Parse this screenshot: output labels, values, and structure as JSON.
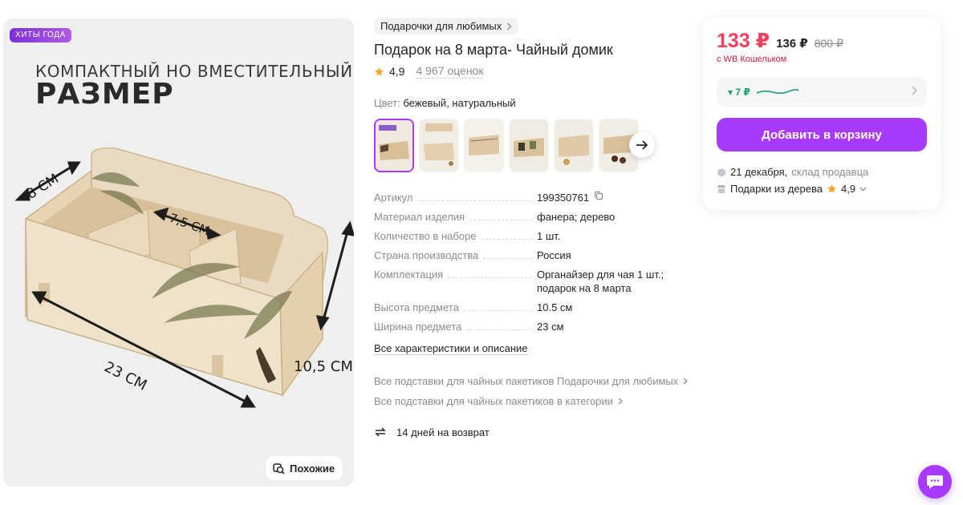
{
  "hero": {
    "badge": "ХИТЫ ГОДА",
    "headline_line1": "КОМПАКТНЫЙ НО ВМЕСТИТЕЛЬНЫЙ",
    "headline_line2": "РАЗМЕР",
    "dimensions": {
      "depth": "8 СМ",
      "compartment": "7,5 СМ",
      "length": "23 СМ",
      "height": "10,5 СМ"
    },
    "similar_button": "Похожие",
    "similar_icon": "search-similar-icon"
  },
  "product": {
    "brand": "Подарочки для любимых",
    "title": "Подарок на 8 марта- Чайный домик",
    "rating": "4,9",
    "reviews": "4 967 оценок",
    "color_label": "Цвет:",
    "color_value": "бежевый, натуральный",
    "thumbnail_count": 6
  },
  "specs": [
    {
      "key": "Артикул",
      "value": "199350761"
    },
    {
      "key": "Материал изделия",
      "value": "фанера; дерево"
    },
    {
      "key": "Количество в наборе",
      "value": "1 шт."
    },
    {
      "key": "Страна производства",
      "value": "Россия"
    },
    {
      "key": "Комплектация",
      "value": "Органайзер для чая 1 шт.; подарок на 8 марта"
    },
    {
      "key": "Высота предмета",
      "value": "10.5 см"
    },
    {
      "key": "Ширина предмета",
      "value": "23 см"
    }
  ],
  "links": {
    "all_specs": "Все характеристики и описание",
    "brand_category": "Все подставки для чайных пакетиков Подарочки для любимых",
    "category": "Все подставки для чайных пакетиков в категории",
    "returns": "14 дней на возврат"
  },
  "price_card": {
    "price": "133 ₽",
    "price_wallet": "136 ₽",
    "price_old": "800 ₽",
    "wallet_note": "с WB Кошельком",
    "price_drop": "▾ 7 ₽",
    "add_to_cart": "Добавить в корзину",
    "delivery_date": "21 декабря,",
    "delivery_from": "склад продавца",
    "seller_name": "Подарки из дерева",
    "seller_rating": "4,9"
  },
  "colors": {
    "accent": "#a73afd",
    "price_red": "#f33e5c",
    "green": "#11a26a",
    "star": "#f4a52c",
    "muted": "#8b8b94"
  }
}
